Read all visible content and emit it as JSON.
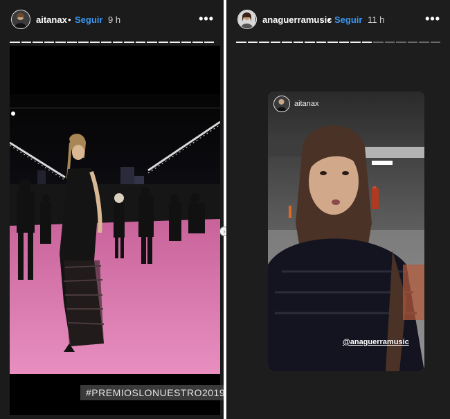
{
  "stories": [
    {
      "username": "aitanax",
      "follow_label": "Seguir",
      "separator": "•",
      "time": "9 h",
      "more_label": "•••",
      "progress": {
        "segments": 18,
        "completed": 18
      },
      "hashtag": "#PREMIOSLONUESTRO2019"
    },
    {
      "username": "anaguerramusic",
      "follow_label": "Seguir",
      "separator": "•",
      "time": "11 h",
      "more_label": "•••",
      "progress": {
        "segments": 18,
        "completed": 12
      },
      "inner_username": "aitanax",
      "mention": "@anaguerramusic"
    }
  ],
  "colors": {
    "story_bg": "#1b1b1b",
    "link_blue": "#3897f0",
    "carpet_pink": "#e07fb4"
  }
}
